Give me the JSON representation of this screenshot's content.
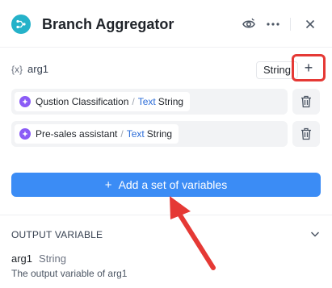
{
  "header": {
    "title": "Branch Aggregator",
    "icons": [
      "branch-app-icon",
      "run-icon",
      "more-icon",
      "close-icon"
    ]
  },
  "variable_group": {
    "label": "arg1",
    "type_value": "String",
    "add_button_label": "+"
  },
  "variables": [
    {
      "node": "Qustion Classification",
      "type_name": "Text",
      "type": "String"
    },
    {
      "node": "Pre-sales assistant",
      "type_name": "Text",
      "type": "String"
    }
  ],
  "add_set": {
    "label": "Add a set of variables"
  },
  "output": {
    "heading": "OUTPUT VARIABLE",
    "name": "arg1",
    "type": "String",
    "description": "The output variable of arg1"
  },
  "colors": {
    "accent": "#3b8cf5",
    "annotation": "#e53935",
    "app_icon": "#25b2c9",
    "node_icon": "#8b5cf6"
  }
}
